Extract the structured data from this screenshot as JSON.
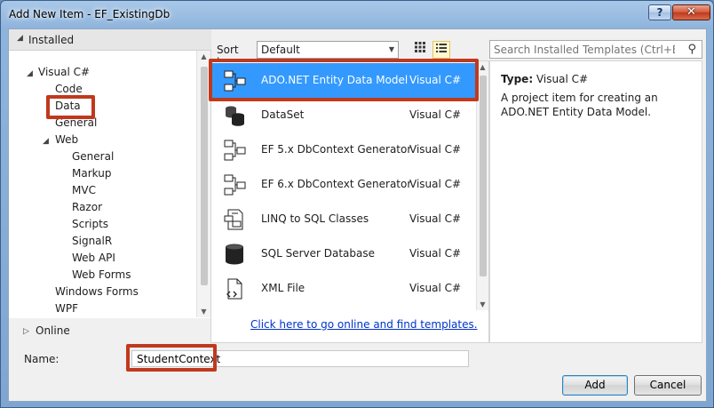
{
  "window": {
    "title": "Add New Item - EF_ExistingDb",
    "help_label": "?",
    "close_label": "✕"
  },
  "tree": {
    "header": "Installed",
    "items": [
      {
        "label": "Visual C#",
        "expanded": true
      },
      {
        "label": "Code"
      },
      {
        "label": "Data"
      },
      {
        "label": "General"
      },
      {
        "label": "Web",
        "expanded": true
      },
      {
        "label": "General"
      },
      {
        "label": "Markup"
      },
      {
        "label": "MVC"
      },
      {
        "label": "Razor"
      },
      {
        "label": "Scripts"
      },
      {
        "label": "SignalR"
      },
      {
        "label": "Web API"
      },
      {
        "label": "Web Forms"
      },
      {
        "label": "Windows Forms"
      },
      {
        "label": "WPF"
      }
    ],
    "online": "Online"
  },
  "sort": {
    "label": "Sort by:",
    "value": "Default"
  },
  "templates": [
    {
      "name": "ADO.NET Entity Data Model",
      "lang": "Visual C#",
      "icon": "entity-model-icon",
      "selected": true
    },
    {
      "name": "DataSet",
      "lang": "Visual C#",
      "icon": "dataset-icon"
    },
    {
      "name": "EF 5.x DbContext Generator",
      "lang": "Visual C#",
      "icon": "entity-model-icon"
    },
    {
      "name": "EF 6.x DbContext Generator",
      "lang": "Visual C#",
      "icon": "entity-model-icon"
    },
    {
      "name": "LINQ to SQL Classes",
      "lang": "Visual C#",
      "icon": "linq-icon"
    },
    {
      "name": "SQL Server Database",
      "lang": "Visual C#",
      "icon": "database-icon"
    },
    {
      "name": "XML File",
      "lang": "Visual C#",
      "icon": "xml-file-icon"
    }
  ],
  "online_link": "Click here to go online and find templates.",
  "search": {
    "placeholder": "Search Installed Templates (Ctrl+E)"
  },
  "info": {
    "type_label": "Type:",
    "type_value": "Visual C#",
    "description": "A project item for creating an ADO.NET Entity Data Model."
  },
  "name": {
    "label": "Name:",
    "value": "StudentContext"
  },
  "buttons": {
    "add": "Add",
    "cancel": "Cancel"
  }
}
